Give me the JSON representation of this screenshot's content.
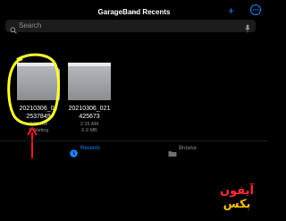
{
  "app": {
    "title": "GarageBand Recents"
  },
  "colors": {
    "accent": "#1f86ff",
    "highlight": "#ffff33",
    "arrow": "#ff1a1a",
    "bg": "#000000"
  },
  "search": {
    "placeholder": "Search"
  },
  "files": [
    {
      "name_line1": "20210306_02",
      "name_line2": "2537849",
      "time": "2:26 AM",
      "status": "1 Waiting",
      "highlighted": true
    },
    {
      "name_line1": "20210306_021",
      "name_line2": "425673",
      "time": "2:15 AM",
      "status": "6.9 MB",
      "highlighted": false
    }
  ],
  "tabs": [
    {
      "label": "Recents",
      "icon": "clock-icon",
      "active": true
    },
    {
      "label": "Browse",
      "icon": "folder-icon",
      "active": false
    }
  ],
  "watermark": {
    "line1": "آیفون",
    "line2": "بکس"
  }
}
